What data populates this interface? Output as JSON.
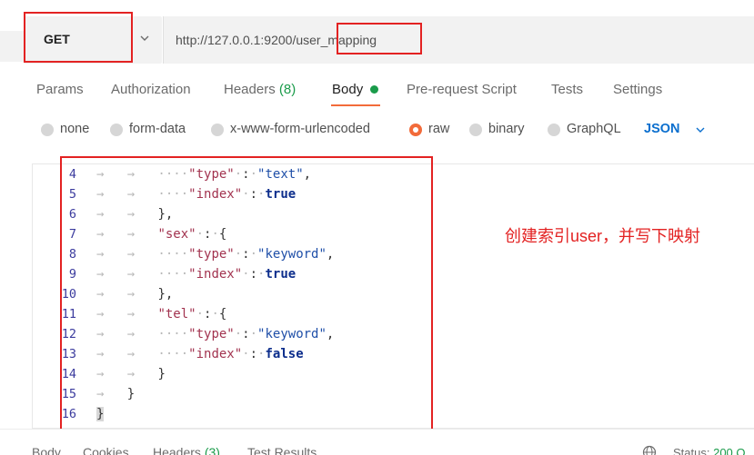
{
  "request": {
    "method": "GET",
    "url": "http://127.0.0.1:9200/user_mapping"
  },
  "tabs": [
    {
      "label": "Params"
    },
    {
      "label": "Authorization"
    },
    {
      "label": "Headers",
      "count": "(8)"
    },
    {
      "label": "Body",
      "active": true
    },
    {
      "label": "Pre-request Script"
    },
    {
      "label": "Tests"
    },
    {
      "label": "Settings"
    }
  ],
  "body_types": [
    {
      "label": "none"
    },
    {
      "label": "form-data"
    },
    {
      "label": "x-www-form-urlencoded"
    },
    {
      "label": "raw",
      "selected": true
    },
    {
      "label": "binary"
    },
    {
      "label": "GraphQL"
    }
  ],
  "body_format": "JSON",
  "editor": {
    "lines": [
      {
        "num": "4",
        "text": "\"type\" : \"text\","
      },
      {
        "num": "5",
        "text": "\"index\" : true"
      },
      {
        "num": "6",
        "text": "},"
      },
      {
        "num": "7",
        "text": "\"sex\" : {"
      },
      {
        "num": "8",
        "text": "\"type\" : \"keyword\","
      },
      {
        "num": "9",
        "text": "\"index\" : true"
      },
      {
        "num": "10",
        "text": "},"
      },
      {
        "num": "11",
        "text": "\"tel\" : {"
      },
      {
        "num": "12",
        "text": "\"type\" : \"keyword\","
      },
      {
        "num": "13",
        "text": "\"index\" : false"
      },
      {
        "num": "14",
        "text": "}"
      },
      {
        "num": "15",
        "text": "}"
      },
      {
        "num": "16",
        "text": "}"
      }
    ]
  },
  "annotation": "创建索引user，并写下映射",
  "response_tabs": [
    {
      "label": "Body"
    },
    {
      "label": "Cookies"
    },
    {
      "label": "Headers",
      "count": "(3)"
    },
    {
      "label": "Test Results"
    }
  ],
  "status": {
    "label": "Status:",
    "value": "200 O"
  },
  "colors": {
    "accent": "#f26b3a",
    "highlight_box": "#e32222",
    "success": "#1a9b4a",
    "link": "#0b6fce"
  }
}
